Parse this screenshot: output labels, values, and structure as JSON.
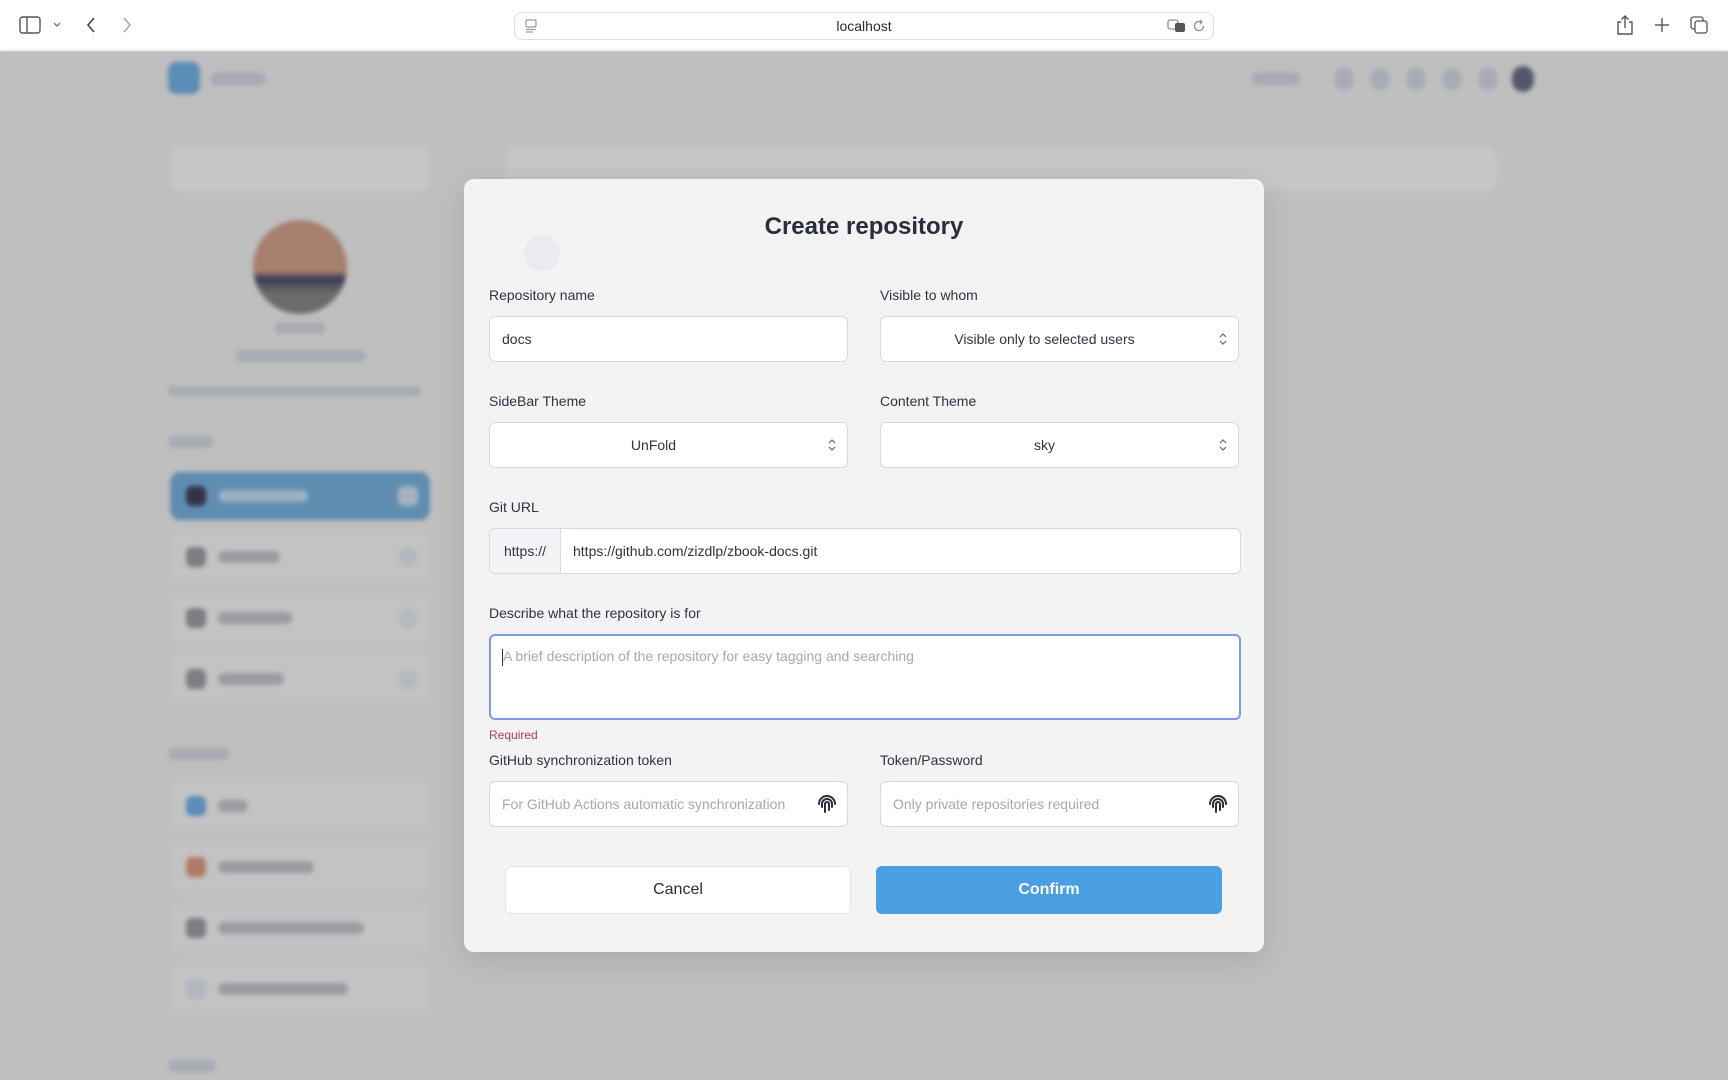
{
  "browser": {
    "url": "localhost",
    "icons": {
      "sidebar": "sidebar-toggle-icon",
      "chevron": "chevron-down-icon",
      "back": "back-icon",
      "forward": "forward-icon",
      "page_menu": "page-menu-icon",
      "translate": "translate-icon",
      "reload": "reload-icon",
      "share": "share-icon",
      "new_tab": "plus-icon",
      "tabs": "tab-overview-icon"
    }
  },
  "background": {
    "note": "blurred page content behind modal",
    "accent_color": "#4a9fe3"
  },
  "modal": {
    "title": "Create repository",
    "repo_name": {
      "label": "Repository name",
      "value": "docs"
    },
    "visibility": {
      "label": "Visible to whom",
      "value": "Visible only to selected users"
    },
    "sidebar_theme": {
      "label": "SideBar Theme",
      "value": "UnFold"
    },
    "content_theme": {
      "label": "Content Theme",
      "value": "sky"
    },
    "git_url": {
      "label": "Git URL",
      "prefix": "https://",
      "value": "https://github.com/zizdlp/zbook-docs.git"
    },
    "description": {
      "label": "Describe what the repository is for",
      "placeholder": "A brief description of the repository for easy tagging and searching",
      "value": "",
      "error": "Required"
    },
    "sync_token": {
      "label": "GitHub synchronization token",
      "placeholder": "For GitHub Actions automatic synchronization",
      "icon": "fingerprint-icon"
    },
    "password": {
      "label": "Token/Password",
      "placeholder": "Only private repositories required",
      "icon": "fingerprint-icon"
    },
    "cancel_label": "Cancel",
    "confirm_label": "Confirm",
    "colors": {
      "confirm": "#4a9fe3",
      "focus_border": "#7b9be6",
      "error": "#b03a6a"
    }
  }
}
